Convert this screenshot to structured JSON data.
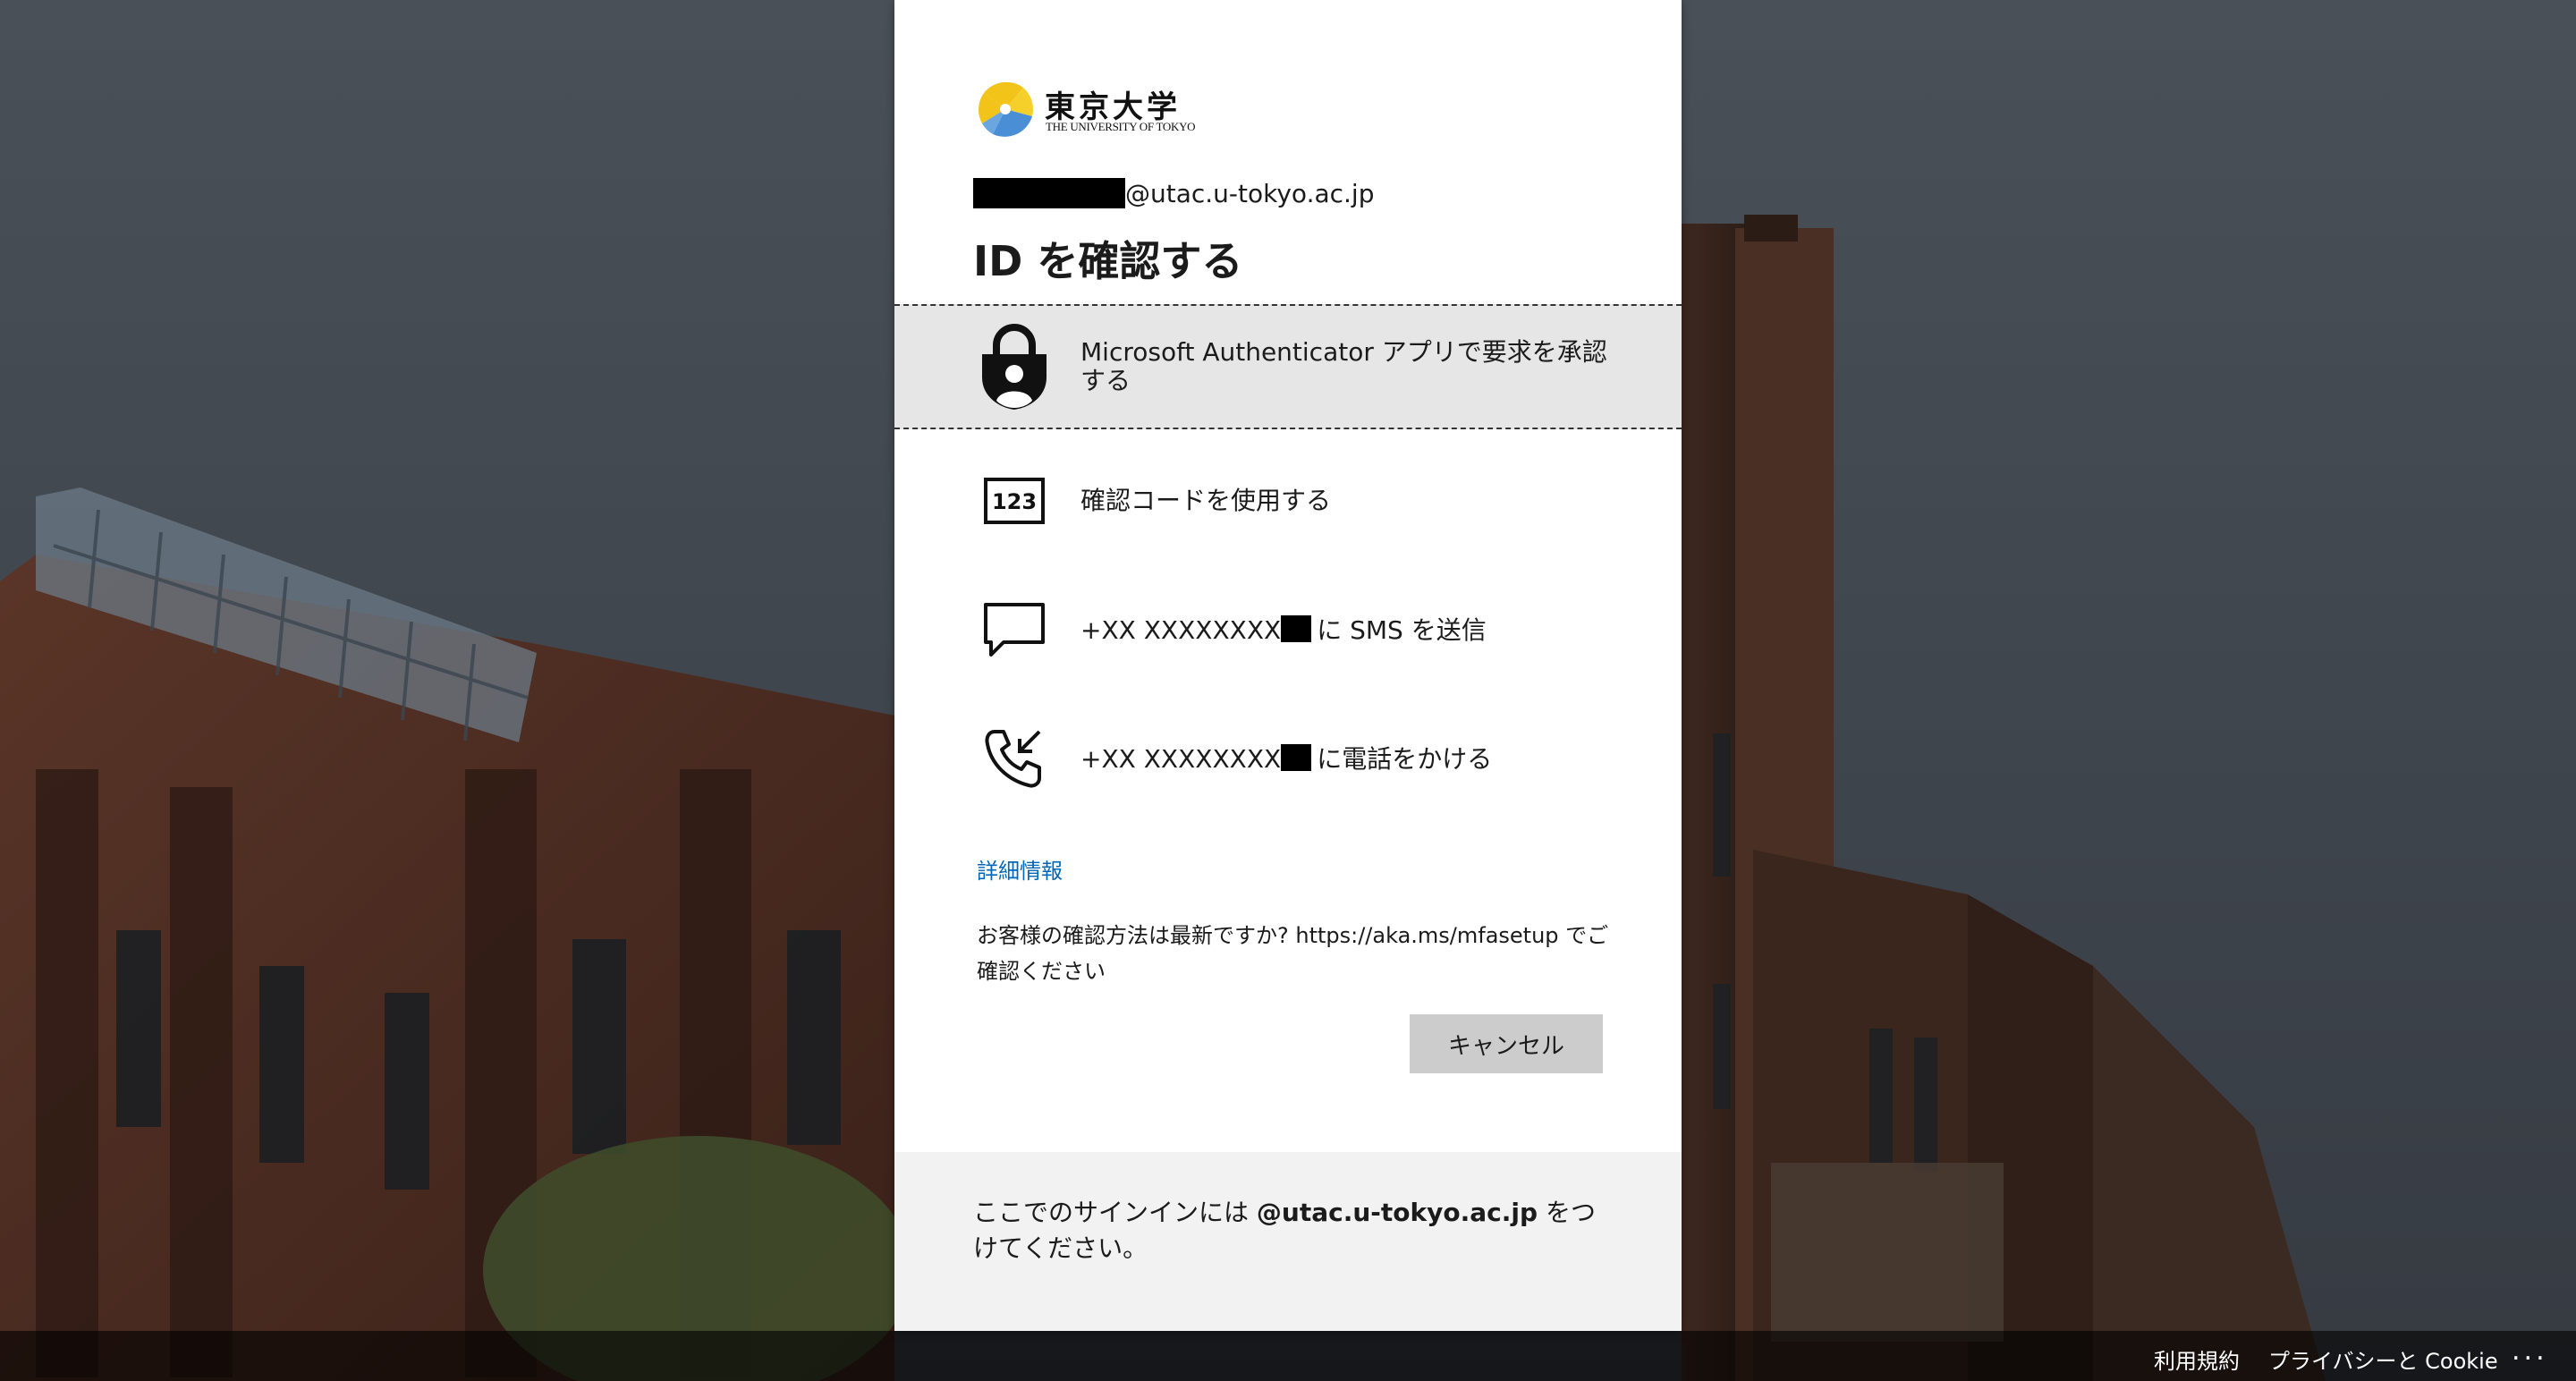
{
  "brand": {
    "name_jp": "東京大学",
    "name_en": "THE UNIVERSITY OF TOKYO"
  },
  "account": {
    "identity_suffix": "@utac.u-tokyo.ac.jp"
  },
  "title": "ID を確認する",
  "methods": [
    {
      "label": "Microsoft Authenticator アプリで要求を承認する",
      "icon": "authenticator-lock-icon",
      "selected": true
    },
    {
      "label": "確認コードを使用する",
      "icon": "verification-code-123-icon",
      "code_glyph": "123"
    },
    {
      "label_prefix": "+XX XXXXXXXX",
      "label_suffix": "に SMS を送信",
      "icon": "sms-chat-bubble-icon"
    },
    {
      "label_prefix": "+XX XXXXXXXX",
      "label_suffix": "に電話をかける",
      "icon": "phone-call-icon"
    }
  ],
  "more_info": "詳細情報",
  "notice": "お客様の確認方法は最新ですか? https://aka.ms/mfasetup でご確認ください",
  "cancel_label": "キャンセル",
  "footer_note": {
    "prefix": "ここでのサインインには ",
    "domain": "@utac.u-tokyo.ac.jp",
    "suffix": " をつけてください。"
  },
  "bottom_bar": {
    "terms": "利用規約",
    "privacy": "プライバシーと Cookie",
    "more": "..."
  },
  "colors": {
    "link": "#0067b8",
    "selected_bg": "#e6e6e6",
    "button_bg": "#cccccc",
    "footer_bg": "#f2f2f2"
  }
}
